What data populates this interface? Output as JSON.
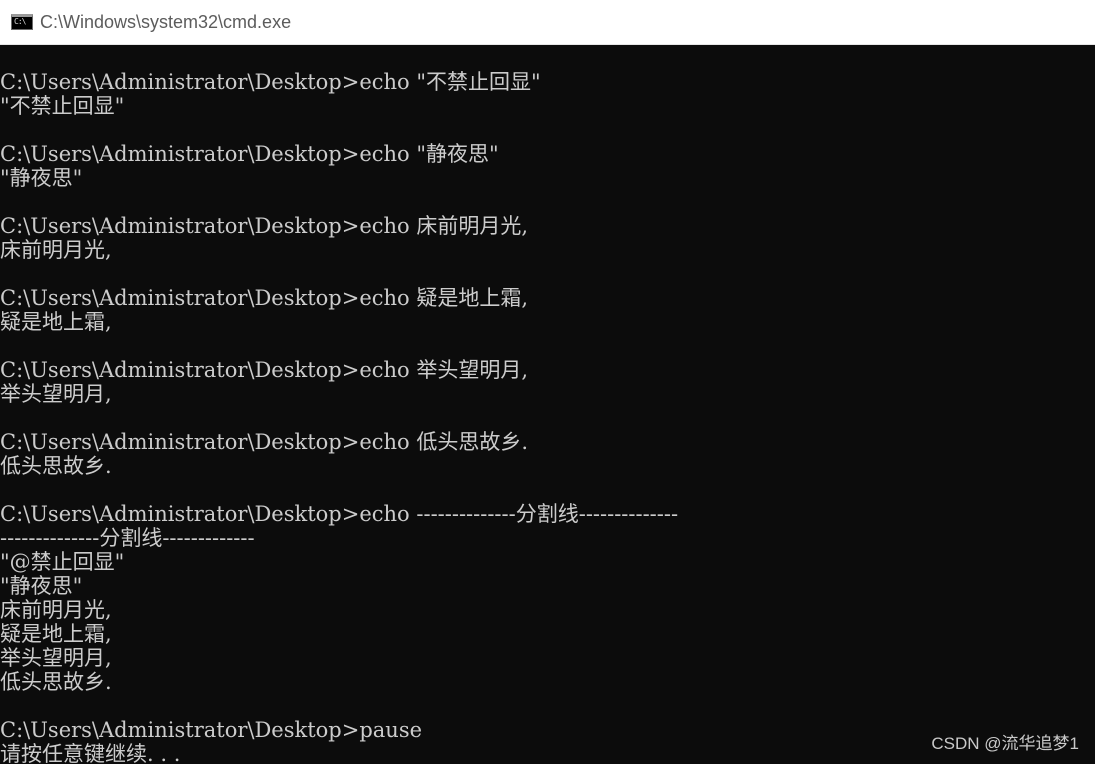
{
  "window": {
    "title": "C:\\Windows\\system32\\cmd.exe",
    "icon_glyph": "C:\\",
    "icon": "cmd-icon"
  },
  "console": {
    "lines": [
      "C:\\Users\\Administrator\\Desktop>echo \"不禁止回显\"",
      "\"不禁止回显\"",
      "",
      "C:\\Users\\Administrator\\Desktop>echo \"静夜思\"",
      "\"静夜思\"",
      "",
      "C:\\Users\\Administrator\\Desktop>echo 床前明月光,",
      "床前明月光,",
      "",
      "C:\\Users\\Administrator\\Desktop>echo 疑是地上霜,",
      "疑是地上霜,",
      "",
      "C:\\Users\\Administrator\\Desktop>echo 举头望明月,",
      "举头望明月,",
      "",
      "C:\\Users\\Administrator\\Desktop>echo 低头思故乡.",
      "低头思故乡.",
      "",
      "C:\\Users\\Administrator\\Desktop>echo --------------分割线--------------",
      "--------------分割线-------------",
      "\"@禁止回显\"",
      "\"静夜思\"",
      "床前明月光,",
      "疑是地上霜,",
      "举头望明月,",
      "低头思故乡.",
      "",
      "C:\\Users\\Administrator\\Desktop>pause",
      "请按任意键继续. . ."
    ]
  },
  "watermark": "CSDN @流华追梦1",
  "colors": {
    "console_bg": "#0c0c0c",
    "console_text": "#cccccc",
    "titlebar_bg": "#ffffff",
    "title_text": "#5c5c5c"
  }
}
